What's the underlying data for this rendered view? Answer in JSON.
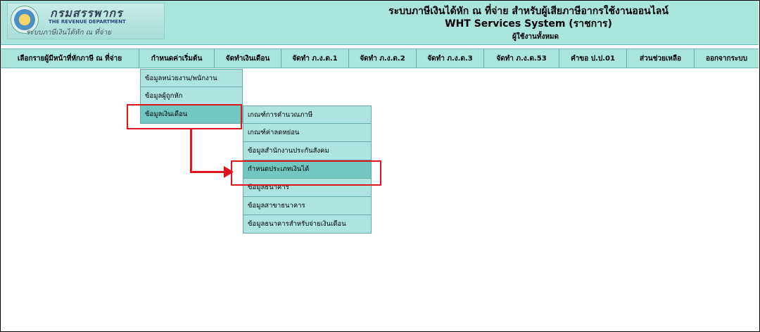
{
  "header": {
    "logo_thai": "กรมสรรพากร",
    "logo_english": "THE REVENUE DEPARTMENT",
    "logo_subtitle": "ระบบภาษีเงินได้หัก ณ ที่จ่าย",
    "title_thai": "ระบบภาษีเงินได้หัก ณ ที่จ่าย สำหรับผู้เสียภาษีอากรใช้งานออนไลน์",
    "title_english": "WHT Services System  (ราชการ)",
    "user_label": "ผู้ใช้งานทั้งหมด"
  },
  "topnav": {
    "items": [
      {
        "label": "เลือกรายผู้มีหน้าที่หักภาษี ณ ที่จ่าย"
      },
      {
        "label": "กำหนดค่าเริ่มต้น"
      },
      {
        "label": "จัดทำเงินเดือน"
      },
      {
        "label": "จัดทำ ภ.ง.ด.1"
      },
      {
        "label": "จัดทำ ภ.ง.ด.2"
      },
      {
        "label": "จัดทำ ภ.ง.ด.3"
      },
      {
        "label": "จัดทำ ภ.ง.ด.53"
      },
      {
        "label": "คำขอ ป.ป.01"
      },
      {
        "label": "ส่วนช่วยเหลือ"
      },
      {
        "label": "ออกจากระบบ"
      }
    ]
  },
  "submenu": {
    "items": [
      {
        "label": "ข้อมูลหน่วยงาน/พนักงาน"
      },
      {
        "label": "ข้อมูลผู้ถูกหัก"
      },
      {
        "label": "ข้อมูลเงินเดือน"
      }
    ]
  },
  "salary_submenu": {
    "items": [
      {
        "label": "เกณฑ์การคำนวณภาษี"
      },
      {
        "label": "เกณฑ์ค่าลดหย่อน"
      },
      {
        "label": "ข้อมูลสำนักงานประกันสังคม"
      },
      {
        "label": "กำหนดประเภทเงินได้"
      },
      {
        "label": "ข้อมูลธนาคาร"
      },
      {
        "label": "ข้อมูลสาขาธนาคาร"
      },
      {
        "label": "ข้อมูลธนาคารสำหรับจ่ายเงินเดือน"
      }
    ]
  },
  "colors": {
    "header_bg": "#a9e4dd",
    "menu_bg": "#aee4df",
    "menu_active": "#72c7c0",
    "highlight": "#e0141e"
  }
}
